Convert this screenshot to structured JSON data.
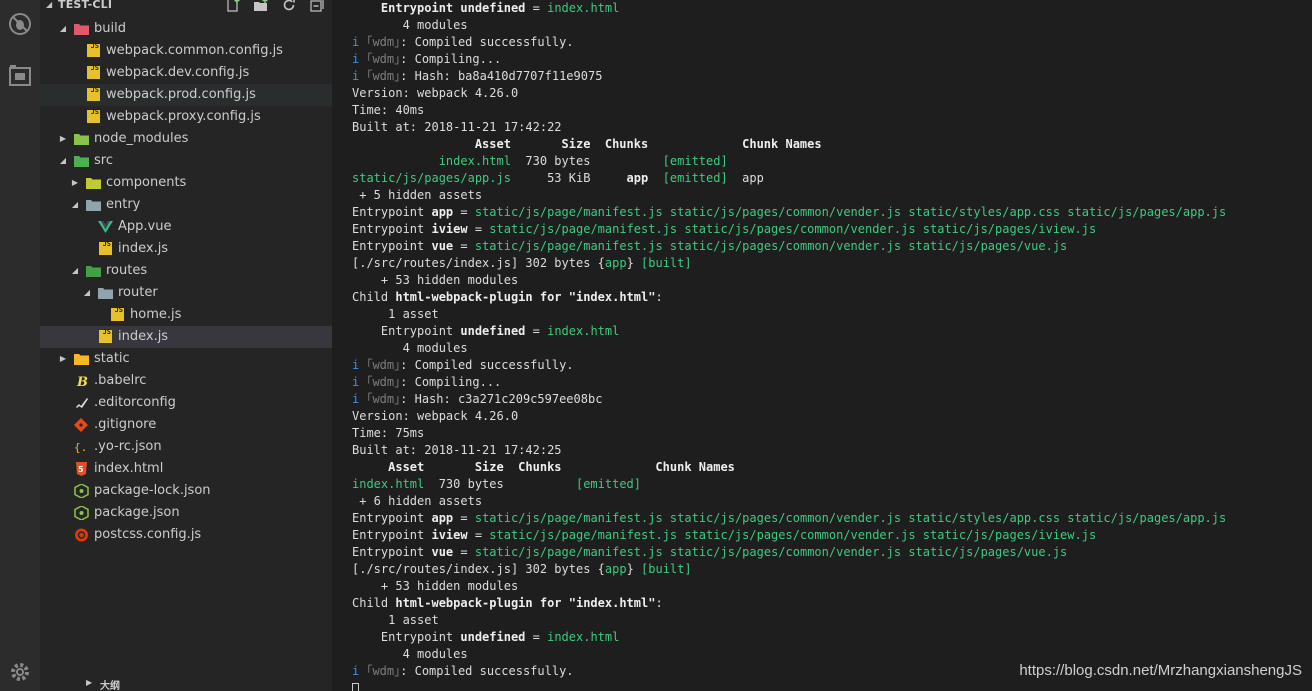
{
  "explorer": {
    "title": "TEST-CLI",
    "bottom_section": "大纲",
    "tree": [
      {
        "label": "build",
        "depth": 1,
        "twisty": "open",
        "icon": "folder-build",
        "color": "#e05a6a"
      },
      {
        "label": "webpack.common.config.js",
        "depth": 2,
        "twisty": "",
        "icon": "js"
      },
      {
        "label": "webpack.dev.config.js",
        "depth": 2,
        "twisty": "",
        "icon": "js"
      },
      {
        "label": "webpack.prod.config.js",
        "depth": 2,
        "twisty": "",
        "icon": "js",
        "state": "hover"
      },
      {
        "label": "webpack.proxy.config.js",
        "depth": 2,
        "twisty": "",
        "icon": "js"
      },
      {
        "label": "node_modules",
        "depth": 1,
        "twisty": "closed",
        "icon": "folder-node",
        "color": "#8bc34a"
      },
      {
        "label": "src",
        "depth": 1,
        "twisty": "open",
        "icon": "folder-src",
        "color": "#4caf50"
      },
      {
        "label": "components",
        "depth": 2,
        "twisty": "closed",
        "icon": "folder-components",
        "color": "#c0ca33"
      },
      {
        "label": "entry",
        "depth": 2,
        "twisty": "open",
        "icon": "folder",
        "color": "#90a4ae"
      },
      {
        "label": "App.vue",
        "depth": 3,
        "twisty": "",
        "icon": "vue",
        "color": "#41b883"
      },
      {
        "label": "index.js",
        "depth": 3,
        "twisty": "",
        "icon": "js"
      },
      {
        "label": "routes",
        "depth": 2,
        "twisty": "open",
        "icon": "folder-routes",
        "color": "#43a047"
      },
      {
        "label": "router",
        "depth": 3,
        "twisty": "open",
        "icon": "folder",
        "color": "#90a4ae"
      },
      {
        "label": "home.js",
        "depth": 4,
        "twisty": "",
        "icon": "js"
      },
      {
        "label": "index.js",
        "depth": 3,
        "twisty": "",
        "icon": "js",
        "state": "selected"
      },
      {
        "label": "static",
        "depth": 1,
        "twisty": "closed",
        "icon": "folder-static",
        "color": "#f5b925"
      },
      {
        "label": ".babelrc",
        "depth": 1,
        "twisty": "",
        "icon": "babel",
        "color": "#f5da55"
      },
      {
        "label": ".editorconfig",
        "depth": 1,
        "twisty": "",
        "icon": "editorconfig",
        "color": "#e0e0e0"
      },
      {
        "label": ".gitignore",
        "depth": 1,
        "twisty": "",
        "icon": "git",
        "color": "#e64a19"
      },
      {
        "label": ".yo-rc.json",
        "depth": 1,
        "twisty": "",
        "icon": "json",
        "color": "#f5b925"
      },
      {
        "label": "index.html",
        "depth": 1,
        "twisty": "",
        "icon": "html",
        "color": "#e44d26"
      },
      {
        "label": "package-lock.json",
        "depth": 1,
        "twisty": "",
        "icon": "npm",
        "color": "#8bc34a"
      },
      {
        "label": "package.json",
        "depth": 1,
        "twisty": "",
        "icon": "npm",
        "color": "#8bc34a"
      },
      {
        "label": "postcss.config.js",
        "depth": 1,
        "twisty": "",
        "icon": "postcss",
        "color": "#dd3a0a"
      }
    ]
  },
  "watermark": "https://blog.csdn.net/MrzhangxianshengJS",
  "terminal_lines": [
    [
      [
        "    Entrypoint ",
        "w"
      ],
      [
        "undefined",
        "w"
      ],
      [
        " = ",
        ""
      ],
      [
        "index.html",
        "g"
      ]
    ],
    [
      [
        "       4 modules",
        ""
      ]
    ],
    [
      [
        "i ",
        "b"
      ],
      [
        "｢wdm｣",
        "gr"
      ],
      [
        ": Compiled successfully.",
        ""
      ]
    ],
    [
      [
        "i ",
        "b"
      ],
      [
        "｢wdm｣",
        "gr"
      ],
      [
        ": Compiling...",
        ""
      ]
    ],
    [
      [
        "i ",
        "b"
      ],
      [
        "｢wdm｣",
        "gr"
      ],
      [
        ": Hash: ba8a410d7707f11e9075",
        ""
      ]
    ],
    [
      [
        "Version: webpack 4.26.0",
        ""
      ]
    ],
    [
      [
        "Time: 40ms",
        ""
      ]
    ],
    [
      [
        "Built at: 2018-11-21 17:42:22",
        ""
      ]
    ],
    [
      [
        "                 Asset       Size  Chunks             Chunk Names",
        "w"
      ]
    ],
    [
      [
        "            index.html",
        "g"
      ],
      [
        "  730 bytes          ",
        ""
      ],
      [
        "[emitted]",
        "g"
      ]
    ],
    [
      [
        "static/js/pages/app.js",
        "g"
      ],
      [
        "     53 KiB     ",
        ""
      ],
      [
        "app",
        "w"
      ],
      [
        "  ",
        ""
      ],
      [
        "[emitted]",
        "g"
      ],
      [
        "  app",
        ""
      ]
    ],
    [
      [
        " + 5 hidden assets",
        ""
      ]
    ],
    [
      [
        "Entrypoint ",
        ""
      ],
      [
        "app",
        "w"
      ],
      [
        " = ",
        ""
      ],
      [
        "static/js/page/manifest.js static/js/pages/common/vender.js static/styles/app.css static/js/pages/app.js",
        "g"
      ]
    ],
    [
      [
        "Entrypoint ",
        ""
      ],
      [
        "iview",
        "w"
      ],
      [
        " = ",
        ""
      ],
      [
        "static/js/page/manifest.js static/js/pages/common/vender.js static/js/pages/iview.js",
        "g"
      ]
    ],
    [
      [
        "Entrypoint ",
        ""
      ],
      [
        "vue",
        "w"
      ],
      [
        " = ",
        ""
      ],
      [
        "static/js/page/manifest.js static/js/pages/common/vender.js static/js/pages/vue.js",
        "g"
      ]
    ],
    [
      [
        "[./src/routes/index.js] 302 bytes {",
        ""
      ],
      [
        "app",
        "g"
      ],
      [
        "} ",
        ""
      ],
      [
        "[built]",
        "g"
      ]
    ],
    [
      [
        "    + 53 hidden modules",
        ""
      ]
    ],
    [
      [
        "Child ",
        ""
      ],
      [
        "html-webpack-plugin for \"index.html\"",
        "w"
      ],
      [
        ":",
        ""
      ]
    ],
    [
      [
        "     1 asset",
        ""
      ]
    ],
    [
      [
        "    Entrypoint ",
        ""
      ],
      [
        "undefined",
        "w"
      ],
      [
        " = ",
        ""
      ],
      [
        "index.html",
        "g"
      ]
    ],
    [
      [
        "       4 modules",
        ""
      ]
    ],
    [
      [
        "i ",
        "b"
      ],
      [
        "｢wdm｣",
        "gr"
      ],
      [
        ": Compiled successfully.",
        ""
      ]
    ],
    [
      [
        "i ",
        "b"
      ],
      [
        "｢wdm｣",
        "gr"
      ],
      [
        ": Compiling...",
        ""
      ]
    ],
    [
      [
        "i ",
        "b"
      ],
      [
        "｢wdm｣",
        "gr"
      ],
      [
        ": Hash: c3a271c209c597ee08bc",
        ""
      ]
    ],
    [
      [
        "Version: webpack 4.26.0",
        ""
      ]
    ],
    [
      [
        "Time: 75ms",
        ""
      ]
    ],
    [
      [
        "Built at: 2018-11-21 17:42:25",
        ""
      ]
    ],
    [
      [
        "     Asset       Size  Chunks             Chunk Names",
        "w"
      ]
    ],
    [
      [
        "index.html",
        "g"
      ],
      [
        "  730 bytes          ",
        ""
      ],
      [
        "[emitted]",
        "g"
      ]
    ],
    [
      [
        " + 6 hidden assets",
        ""
      ]
    ],
    [
      [
        "Entrypoint ",
        ""
      ],
      [
        "app",
        "w"
      ],
      [
        " = ",
        ""
      ],
      [
        "static/js/page/manifest.js static/js/pages/common/vender.js static/styles/app.css static/js/pages/app.js",
        "g"
      ]
    ],
    [
      [
        "Entrypoint ",
        ""
      ],
      [
        "iview",
        "w"
      ],
      [
        " = ",
        ""
      ],
      [
        "static/js/page/manifest.js static/js/pages/common/vender.js static/js/pages/iview.js",
        "g"
      ]
    ],
    [
      [
        "Entrypoint ",
        ""
      ],
      [
        "vue",
        "w"
      ],
      [
        " = ",
        ""
      ],
      [
        "static/js/page/manifest.js static/js/pages/common/vender.js static/js/pages/vue.js",
        "g"
      ]
    ],
    [
      [
        "[./src/routes/index.js] 302 bytes {",
        ""
      ],
      [
        "app",
        "g"
      ],
      [
        "} ",
        ""
      ],
      [
        "[built]",
        "g"
      ]
    ],
    [
      [
        "    + 53 hidden modules",
        ""
      ]
    ],
    [
      [
        "Child ",
        ""
      ],
      [
        "html-webpack-plugin for \"index.html\"",
        "w"
      ],
      [
        ":",
        ""
      ]
    ],
    [
      [
        "     1 asset",
        ""
      ]
    ],
    [
      [
        "    Entrypoint ",
        ""
      ],
      [
        "undefined",
        "w"
      ],
      [
        " = ",
        ""
      ],
      [
        "index.html",
        "g"
      ]
    ],
    [
      [
        "       4 modules",
        ""
      ]
    ],
    [
      [
        "i ",
        "b"
      ],
      [
        "｢wdm｣",
        "gr"
      ],
      [
        ": Compiled successfully.",
        ""
      ]
    ]
  ]
}
